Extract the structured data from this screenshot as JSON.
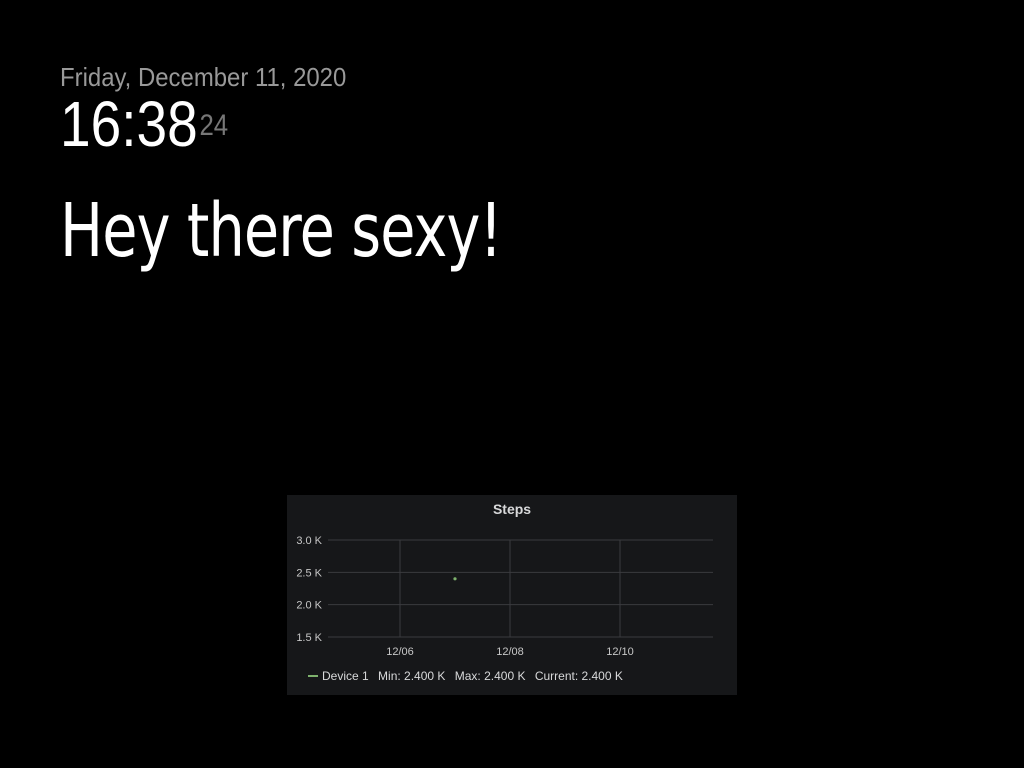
{
  "clock": {
    "date": "Friday, December 11, 2020",
    "time": "16:38",
    "seconds": "24"
  },
  "greeting": "Hey there sexy!",
  "panel": {
    "title": "Steps",
    "legend": {
      "series": "Device 1",
      "min": "Min: 2.400 K",
      "max": "Max: 2.400 K",
      "current": "Current: 2.400 K",
      "color": "#7eb26d"
    }
  },
  "chart_data": {
    "type": "scatter",
    "title": "Steps",
    "xlabel": "",
    "ylabel": "",
    "x_tick_labels": [
      "12/06",
      "12/08",
      "12/10"
    ],
    "y_tick_labels": [
      "3.0 K",
      "2.5 K",
      "2.0 K",
      "1.5 K"
    ],
    "y_ticks": [
      3000,
      2500,
      2000,
      1500
    ],
    "ylim": [
      1500,
      3000
    ],
    "grid": true,
    "series": [
      {
        "name": "Device 1",
        "color": "#7eb26d",
        "points": [
          {
            "x": "12/07",
            "y": 2400
          }
        ]
      }
    ]
  }
}
